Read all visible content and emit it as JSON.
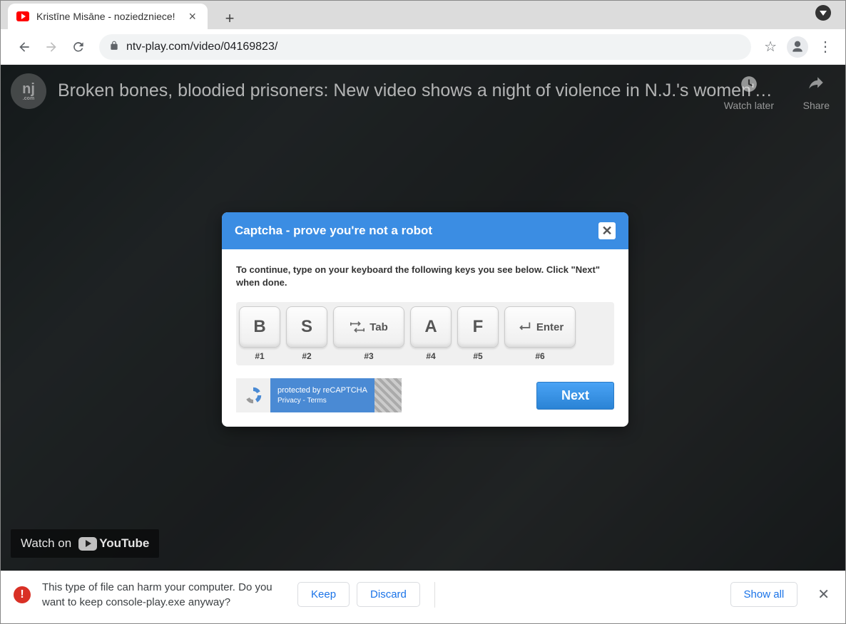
{
  "window": {
    "min": "—",
    "max": "❐",
    "close": "✕"
  },
  "tab": {
    "title": "Kristīne Misāne - noziedzniece!"
  },
  "url": {
    "display": "ntv-play.com/video/04169823/"
  },
  "video": {
    "channel": "nj",
    "channel_sub": ".com",
    "title": "Broken bones, bloodied prisoners: New video shows a night of violence in N.J.'s women'…",
    "watch_later": "Watch later",
    "share": "Share",
    "watch_on": "Watch on",
    "youtube": "YouTube"
  },
  "captcha": {
    "title": "Captcha - prove you're not a robot",
    "instructions": "To continue, type on your keyboard the following keys you see below. Click \"Next\" when done.",
    "keys": [
      {
        "label": "B",
        "num": "#1"
      },
      {
        "label": "S",
        "num": "#2"
      },
      {
        "label": "Tab",
        "num": "#3",
        "special": "tab"
      },
      {
        "label": "A",
        "num": "#4"
      },
      {
        "label": "F",
        "num": "#5"
      },
      {
        "label": "Enter",
        "num": "#6",
        "special": "enter"
      }
    ],
    "recaptcha": {
      "line1": "protected by reCAPTCHA",
      "line2": "Privacy - Terms"
    },
    "next": "Next"
  },
  "download": {
    "warning": "This type of file can harm your computer. Do you want to keep console-play.exe anyway?",
    "keep": "Keep",
    "discard": "Discard",
    "showall": "Show all"
  }
}
